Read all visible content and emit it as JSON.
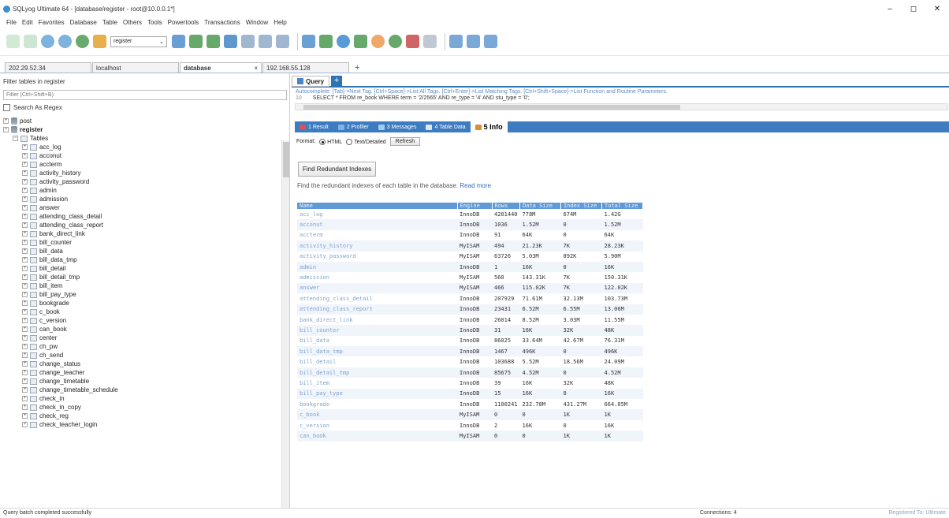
{
  "window": {
    "title": "SQLyog Ultimate 64 - [database/register - root@10.0.0.1*]",
    "buttons": [
      "–",
      "◻",
      "✕"
    ]
  },
  "menu": [
    "File",
    "Edit",
    "Favorites",
    "Database",
    "Table",
    "Others",
    "Tools",
    "Powertools",
    "Transactions",
    "Window",
    "Help"
  ],
  "toolbar": {
    "db_select": "register"
  },
  "connection_tabs": [
    {
      "label": "202.29.52.34"
    },
    {
      "label": "localhost"
    },
    {
      "label": "database",
      "active": true
    },
    {
      "label": "192.168.55.128"
    }
  ],
  "left": {
    "filter_label": "Filter tables in register",
    "filter_placeholder": "Filter (Ctrl+Shift+B)",
    "regex_label": "Search As Regex",
    "db1": "post",
    "db2": "register",
    "folder": "Tables",
    "tables": [
      "acc_log",
      "acconut",
      "accterm",
      "activity_history",
      "activity_password",
      "admin",
      "admission",
      "answer",
      "attending_class_detail",
      "attending_class_report",
      "bank_direct_link",
      "bill_counter",
      "bill_data",
      "bill_data_tmp",
      "bill_detail",
      "bill_detail_tmp",
      "bill_item",
      "bill_pay_type",
      "bookgrade",
      "c_book",
      "c_version",
      "can_book",
      "center",
      "ch_pw",
      "ch_send",
      "change_status",
      "change_teacher",
      "change_timetable",
      "change_timetable_schedule",
      "check_in",
      "check_in_copy",
      "check_reg",
      "check_teacher_login"
    ]
  },
  "query": {
    "tab": "Query",
    "autocomplete": "Autocomplete: [Tab]->Next Tag. [Ctrl+Space]->List All Tags. [Ctrl+Enter]->List Matching Tags. [Ctrl+Shift+Space]->List Function and Routine Parameters.",
    "line": "10",
    "sql": "SELECT * FROM re_book WHERE term = '2/2565' AND re_type = '4' AND stu_type = '0';"
  },
  "result_tabs": [
    "1 Result",
    "2 Profiler",
    "3 Messages",
    "4 Table Data",
    "5 Info"
  ],
  "format": {
    "label": "Format:",
    "html": "HTML",
    "text": "Text/Detailed",
    "refresh": "Refresh"
  },
  "redundant_btn": "Find Redundant Indexes",
  "desc": "Find the redundant indexes of each table in the database.",
  "read_more": "Read more",
  "info": {
    "headers": [
      "Name",
      "Engine",
      "Rows",
      "Data Size",
      "Index Size",
      "Total Size"
    ],
    "rows": [
      [
        "acc_log",
        "InnoDB",
        "4201440",
        "778M",
        "674M",
        "1.42G"
      ],
      [
        "acconut",
        "InnoDB",
        "1036",
        "1.52M",
        "0",
        "1.52M"
      ],
      [
        "accterm",
        "InnoDB",
        "91",
        "64K",
        "0",
        "64K"
      ],
      [
        "activity_history",
        "MyISAM",
        "494",
        "21.23K",
        "7K",
        "28.23K"
      ],
      [
        "activity_password",
        "MyISAM",
        "63726",
        "5.03M",
        "892K",
        "5.90M"
      ],
      [
        "admin",
        "InnoDB",
        "1",
        "16K",
        "0",
        "16K"
      ],
      [
        "admission",
        "MyISAM",
        "560",
        "143.31K",
        "7K",
        "150.31K"
      ],
      [
        "answer",
        "MyISAM",
        "466",
        "115.02K",
        "7K",
        "122.02K"
      ],
      [
        "attending_class_detail",
        "InnoDB",
        "207929",
        "71.61M",
        "32.13M",
        "103.73M"
      ],
      [
        "attending_class_report",
        "InnoDB",
        "23431",
        "6.52M",
        "6.55M",
        "13.06M"
      ],
      [
        "bank_direct_link",
        "InnoDB",
        "26014",
        "8.52M",
        "3.03M",
        "11.55M"
      ],
      [
        "bill_counter",
        "InnoDB",
        "31",
        "16K",
        "32K",
        "48K"
      ],
      [
        "bill_data",
        "InnoDB",
        "86025",
        "33.64M",
        "42.67M",
        "76.31M"
      ],
      [
        "bill_data_tmp",
        "InnoDB",
        "1467",
        "496K",
        "0",
        "496K"
      ],
      [
        "bill_detail",
        "InnoDB",
        "103688",
        "5.52M",
        "18.56M",
        "24.09M"
      ],
      [
        "bill_detail_tmp",
        "InnoDB",
        "85675",
        "4.52M",
        "0",
        "4.52M"
      ],
      [
        "bill_item",
        "InnoDB",
        "39",
        "16K",
        "32K",
        "48K"
      ],
      [
        "bill_pay_type",
        "InnoDB",
        "15",
        "16K",
        "0",
        "16K"
      ],
      [
        "bookgrade",
        "InnoDB",
        "1100241",
        "232.78M",
        "431.27M",
        "664.05M"
      ],
      [
        "c_book",
        "MyISAM",
        "0",
        "0",
        "1K",
        "1K"
      ],
      [
        "c_version",
        "InnoDB",
        "2",
        "16K",
        "0",
        "16K"
      ],
      [
        "can_book",
        "MyISAM",
        "0",
        "0",
        "1K",
        "1K"
      ]
    ]
  },
  "status": {
    "left": "Query batch completed successfully",
    "mid": "Connections: 4",
    "right": "Registered To: Ultimate"
  },
  "colors": {
    "accent": "#3d7cc1",
    "header": "#5f9ad6"
  }
}
